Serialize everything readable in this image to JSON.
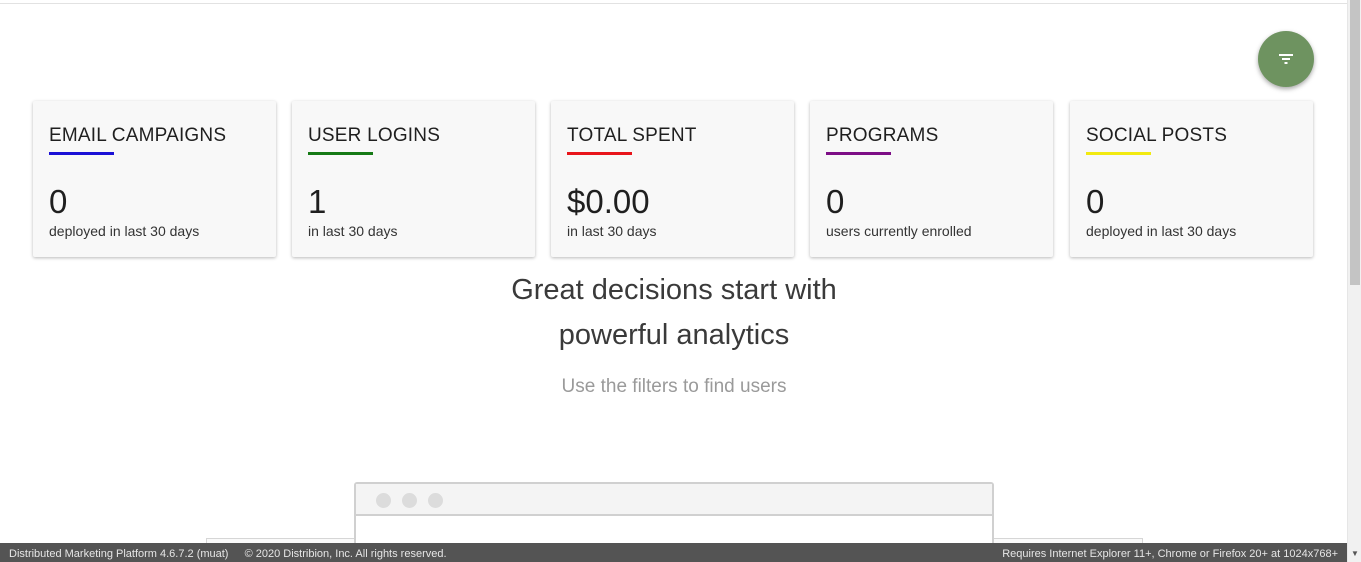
{
  "filter_button": {
    "icon": "filter-icon",
    "color": "#6e9360"
  },
  "cards": [
    {
      "title": "EMAIL CAMPAIGNS",
      "value": "0",
      "caption": "deployed in last 30 days",
      "accent": "#1a10d6"
    },
    {
      "title": "USER LOGINS",
      "value": "1",
      "caption": "in last 30 days",
      "accent": "#167a16"
    },
    {
      "title": "TOTAL SPENT",
      "value": "$0.00",
      "caption": "in last 30 days",
      "accent": "#e8141a"
    },
    {
      "title": "PROGRAMS",
      "value": "0",
      "caption": "users currently enrolled",
      "accent": "#7d0e86"
    },
    {
      "title": "SOCIAL POSTS",
      "value": "0",
      "caption": "deployed in last 30 days",
      "accent": "#f2ea10"
    }
  ],
  "empty_state": {
    "headline_line1": "Great decisions start with",
    "headline_line2": "powerful analytics",
    "subtitle": "Use the filters to find users"
  },
  "footer": {
    "version": "Distributed Marketing Platform 4.6.7.2 (muat)",
    "copyright": "© 2020 Distribion, Inc. All rights reserved.",
    "requirements": "Requires Internet Explorer 11+, Chrome or Firefox 20+ at 1024x768+"
  }
}
